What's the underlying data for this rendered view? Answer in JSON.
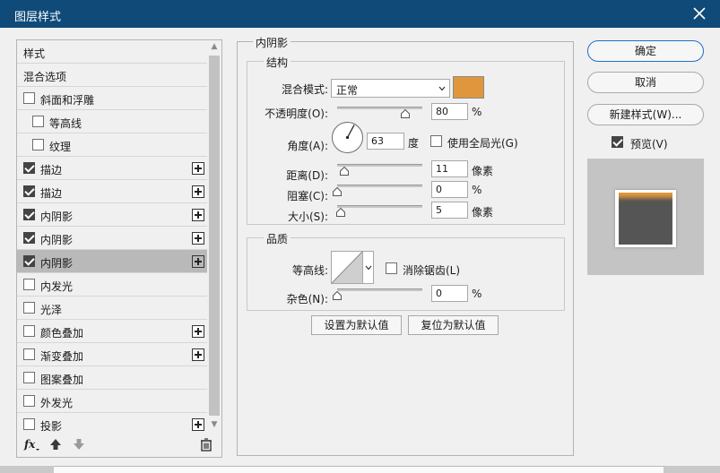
{
  "window": {
    "title": "图层样式"
  },
  "left_list": {
    "items": [
      {
        "label": "样式",
        "type": "header"
      },
      {
        "label": "混合选项",
        "type": "header"
      },
      {
        "label": "斜面和浮雕",
        "checked": false,
        "indent": 0,
        "plus": false
      },
      {
        "label": "等高线",
        "checked": false,
        "indent": 1,
        "plus": false
      },
      {
        "label": "纹理",
        "checked": false,
        "indent": 1,
        "plus": false
      },
      {
        "label": "描边",
        "checked": true,
        "indent": 0,
        "plus": true
      },
      {
        "label": "描边",
        "checked": true,
        "indent": 0,
        "plus": true
      },
      {
        "label": "内阴影",
        "checked": true,
        "indent": 0,
        "plus": true
      },
      {
        "label": "内阴影",
        "checked": true,
        "indent": 0,
        "plus": true
      },
      {
        "label": "内阴影",
        "checked": true,
        "indent": 0,
        "plus": true,
        "selected": true
      },
      {
        "label": "内发光",
        "checked": false,
        "indent": 0,
        "plus": false
      },
      {
        "label": "光泽",
        "checked": false,
        "indent": 0,
        "plus": false
      },
      {
        "label": "颜色叠加",
        "checked": false,
        "indent": 0,
        "plus": true
      },
      {
        "label": "渐变叠加",
        "checked": false,
        "indent": 0,
        "plus": true
      },
      {
        "label": "图案叠加",
        "checked": false,
        "indent": 0,
        "plus": false
      },
      {
        "label": "外发光",
        "checked": false,
        "indent": 0,
        "plus": false
      },
      {
        "label": "投影",
        "checked": false,
        "indent": 0,
        "plus": true
      }
    ],
    "footer_icons": [
      "fx-icon",
      "move-up-icon",
      "move-down-icon",
      "trash-icon"
    ]
  },
  "inner_shadow": {
    "section_title": "内阴影",
    "structure": {
      "title": "结构",
      "blend_mode_label": "混合模式:",
      "blend_mode_value": "正常",
      "color": "#e0963c",
      "opacity_label": "不透明度(O):",
      "opacity_value": "80",
      "opacity_unit": "%",
      "angle_label": "角度(A):",
      "angle_value": "63",
      "angle_unit": "度",
      "global_light_label": "使用全局光(G)",
      "global_light_checked": false,
      "distance_label": "距离(D):",
      "distance_value": "11",
      "distance_unit": "像素",
      "choke_label": "阻塞(C):",
      "choke_value": "0",
      "choke_unit": "%",
      "size_label": "大小(S):",
      "size_value": "5",
      "size_unit": "像素"
    },
    "quality": {
      "title": "品质",
      "contour_label": "等高线:",
      "antialias_label": "消除锯齿(L)",
      "antialias_checked": false,
      "noise_label": "杂色(N):",
      "noise_value": "0",
      "noise_unit": "%"
    },
    "buttons": {
      "set_default": "设置为默认值",
      "reset_default": "复位为默认值"
    }
  },
  "right": {
    "ok": "确定",
    "cancel": "取消",
    "new_style": "新建样式(W)...",
    "preview_label": "预览(V)",
    "preview_checked": true
  },
  "colors": {
    "titlebar": "#0f4a78",
    "shadow_color": "#e0963c",
    "primary_border": "#1e6fc8"
  }
}
